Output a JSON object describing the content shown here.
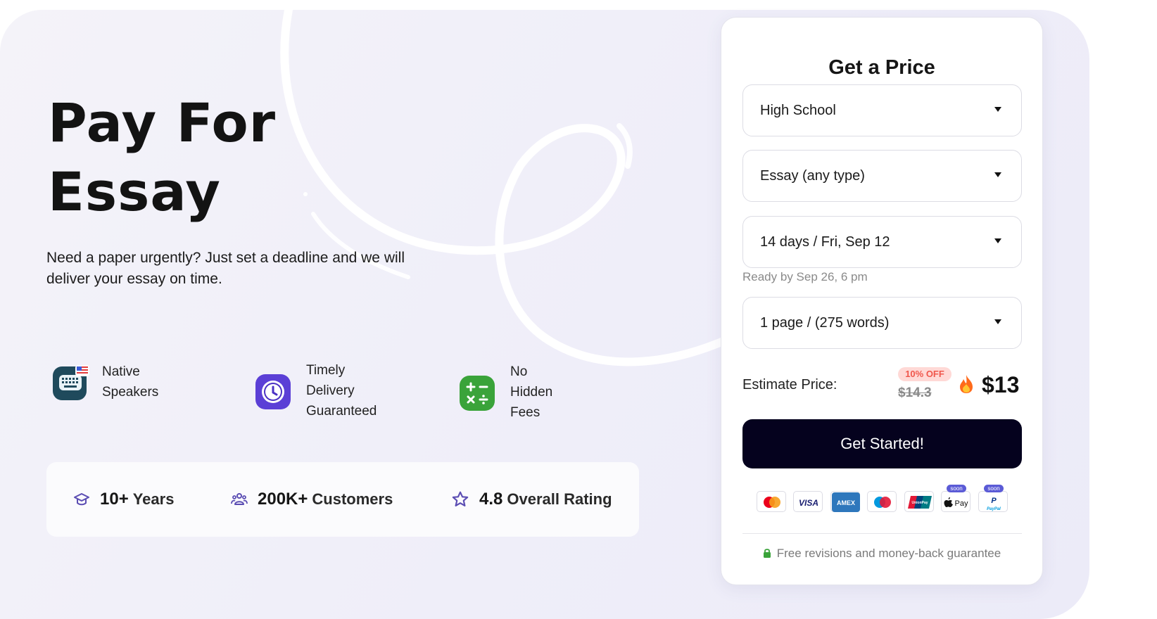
{
  "hero": {
    "title_line1": "Pay For",
    "title_line2": "Essay",
    "subtitle": "Need a paper urgently? Just set a deadline and we will deliver your essay on time."
  },
  "features": [
    {
      "icon": "keyboard-flag-icon",
      "line1": "Native Speakers",
      "line2": ""
    },
    {
      "icon": "clock-icon",
      "line1": "Timely Delivery",
      "line2": "Guaranteed"
    },
    {
      "icon": "calculator-icon",
      "line1": "No Hidden Fees",
      "line2": ""
    }
  ],
  "stats": [
    {
      "icon": "graduation-cap-icon",
      "number": "10+",
      "label": "Years"
    },
    {
      "icon": "users-icon",
      "number": "200K+",
      "label": "Customers"
    },
    {
      "icon": "star-icon",
      "number": "4.8",
      "label": "Overall Rating"
    }
  ],
  "price_card": {
    "title": "Get a Price",
    "academic_level": "High School",
    "paper_type": "Essay (any type)",
    "deadline": "14 days / Fri, Sep 12",
    "ready_by": "Ready by Sep 26, 6 pm",
    "pages": "1 page / (275 words)",
    "estimate_label": "Estimate Price:",
    "discount_badge": "10% OFF",
    "old_price": "$14.3",
    "price": "$13",
    "cta_label": "Get Started!",
    "payment_methods": [
      {
        "name": "mastercard-icon",
        "soon": ""
      },
      {
        "name": "visa-icon",
        "label": "VISA",
        "soon": ""
      },
      {
        "name": "amex-icon",
        "label": "AMEX",
        "soon": ""
      },
      {
        "name": "maestro-icon",
        "soon": ""
      },
      {
        "name": "unionpay-icon",
        "label": "UnionPay",
        "soon": ""
      },
      {
        "name": "apple-pay-icon",
        "label": "Pay",
        "soon": "soon"
      },
      {
        "name": "paypal-icon",
        "label": "PayPal",
        "soon": "soon"
      }
    ],
    "guarantee": "Free revisions and money-back guarantee"
  },
  "colors": {
    "accent": "#5b4db3",
    "cta_bg": "#05021e",
    "discount_bg": "#ffd9d6",
    "discount_text": "#f0574c"
  }
}
